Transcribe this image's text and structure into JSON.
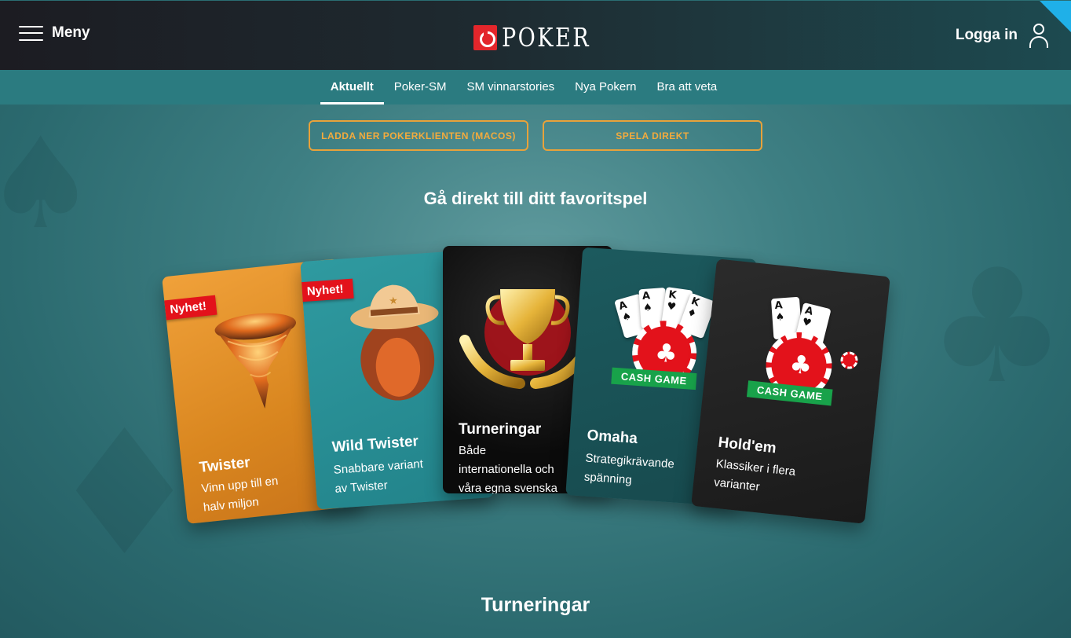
{
  "header": {
    "menu_label": "Meny",
    "logo_text": "POKER",
    "login_label": "Logga in"
  },
  "subnav": {
    "tabs": [
      {
        "label": "Aktuellt",
        "active": true
      },
      {
        "label": "Poker-SM",
        "active": false
      },
      {
        "label": "SM vinnarstories",
        "active": false
      },
      {
        "label": "Nya Pokern",
        "active": false
      },
      {
        "label": "Bra att veta",
        "active": false
      }
    ]
  },
  "cta": {
    "download_label": "LADDA NER POKERKLIENTEN (MACOS)",
    "play_label": "SPELA DIREKT"
  },
  "favorites": {
    "title": "Gå direkt till ditt favoritspel",
    "cards": [
      {
        "name": "Twister",
        "desc_line1": "Vinn upp till en",
        "desc_line2": "halv miljon",
        "badge": "Nyhet!"
      },
      {
        "name": "Wild Twister",
        "desc_line1": "Snabbare variant",
        "desc_line2": "av Twister",
        "badge": "Nyhet!"
      },
      {
        "name": "Turneringar",
        "desc_line1": "Både",
        "desc_line2": "internationella och",
        "desc_line3": "våra egna svenska"
      },
      {
        "name": "Omaha",
        "desc_line1": "Strategikrävande",
        "desc_line2": "spänning",
        "banner": "CASH GAME"
      },
      {
        "name": "Hold'em",
        "desc_line1": "Klassiker i flera",
        "desc_line2": "varianter",
        "banner": "CASH GAME"
      }
    ]
  },
  "tournaments_section": {
    "title": "Turneringar"
  },
  "colors": {
    "accent_orange": "#f3ab3d",
    "brand_red": "#e3262b",
    "corner_flag": "#1fb0e8",
    "subnav_bg": "#2b7b80"
  }
}
